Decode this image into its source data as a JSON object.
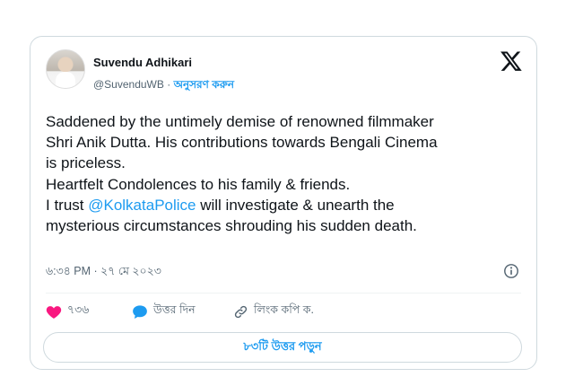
{
  "tweet": {
    "author_name": "Suvendu Adhikari",
    "handle": "@SuvenduWB",
    "separator": "·",
    "follow_label": "অনুসরণ করুন",
    "body_lines": [
      "Saddened by the untimely demise of renowned filmmaker",
      "Shri Anik Dutta. His contributions towards Bengali Cinema",
      "is priceless.",
      "Heartfelt Condolences to his family & friends."
    ],
    "trust_prefix": "I trust ",
    "mention": "@KolkataPolice",
    "trust_suffix": " will investigate & unearth the",
    "last_line": "mysterious circumstances shrouding his sudden death.",
    "timestamp": "৬:৩৪ PM · ২৭ মে ২০২৩"
  },
  "actions": {
    "like_count": "৭৩৬",
    "reply_label": "উত্তর দিন",
    "copy_link_label": "লিংক কপি ক."
  },
  "read_replies_label": "৮৩টি উত্তর পড়ুন",
  "icons": {
    "platform": "x-logo-icon",
    "info": "info-icon",
    "like": "heart-icon",
    "reply": "speech-bubble-icon",
    "copy_link": "link-icon"
  },
  "colors": {
    "accent": "#1d9bf0",
    "like": "#f91880",
    "text": "#0f1419",
    "muted": "#536471"
  }
}
